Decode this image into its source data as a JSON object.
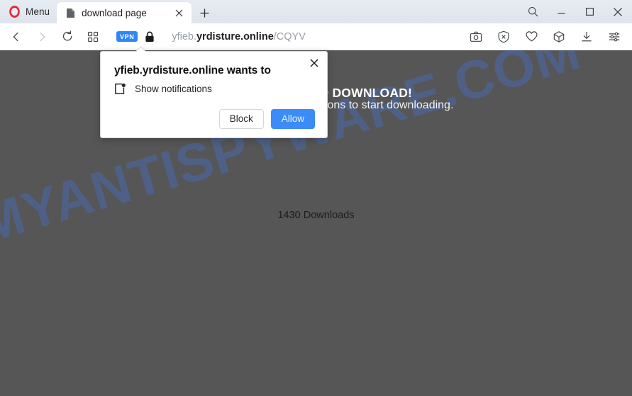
{
  "browser": {
    "name": "Opera",
    "menu_label": "Menu",
    "tabs": [
      {
        "title": "download page",
        "favicon": "page-icon",
        "close_label": "×"
      }
    ],
    "new_tab_label": "+",
    "window_controls": [
      {
        "name": "search-icon",
        "label": "Search"
      },
      {
        "name": "minimize-icon",
        "label": "Minimize"
      },
      {
        "name": "maximize-icon",
        "label": "Maximize"
      },
      {
        "name": "close-icon",
        "label": "Close"
      }
    ],
    "toolbar": {
      "back_label": "Back",
      "forward_label": "Forward",
      "reload_label": "Reload",
      "speeddial_label": "Speed Dial",
      "vpn_badge": "VPN",
      "lock_label": "Secure connection",
      "right_icons": [
        {
          "name": "snapshot-icon",
          "label": "Snapshot"
        },
        {
          "name": "adblocker-icon",
          "label": "Ad blocker"
        },
        {
          "name": "heart-icon",
          "label": "Add to favorites"
        },
        {
          "name": "extensions-cube-icon",
          "label": "Extensions"
        },
        {
          "name": "downloads-icon",
          "label": "Downloads"
        },
        {
          "name": "easy-setup-icon",
          "label": "Easy setup"
        }
      ]
    },
    "url": {
      "subdomain": "yfieb.",
      "domain": "yrdisture.online",
      "path": "/CQYV",
      "full": "yfieb.yrdisture.online/CQYV"
    }
  },
  "page": {
    "heading": "CLICK ALLOW TO DOWNLOAD!",
    "subtext": "Click Allow to enable notifications to start downloading.",
    "downloads_count": "1430 Downloads",
    "watermark": "MYANTISPYWARE.COM",
    "background_color": "#565656",
    "watermark_color": "#4a67a3"
  },
  "permission_dialog": {
    "title": "yfieb.yrdisture.online wants to",
    "permission_label": "Show notifications",
    "permission_icon": "notification-bell-icon",
    "close_label": "×",
    "block_label": "Block",
    "allow_label": "Allow",
    "allow_color": "#3b8cf6"
  }
}
